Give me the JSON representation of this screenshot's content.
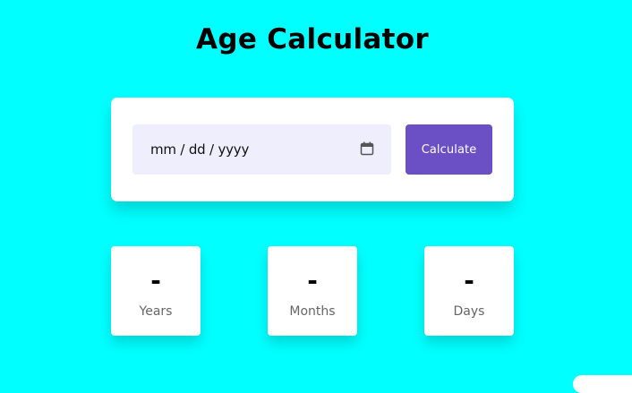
{
  "page": {
    "title": "Age Calculator",
    "background": "#00ffff"
  },
  "input_card": {
    "date_placeholder": "mm / dd / yyyy",
    "calendar_icon": "calendar-icon",
    "calculate_label": "Calculate",
    "button_color": "#6b4fc4",
    "field_color": "#efeefd"
  },
  "results": [
    {
      "value": "-",
      "label": "Years"
    },
    {
      "value": "-",
      "label": "Months"
    },
    {
      "value": "-",
      "label": "Days"
    }
  ]
}
